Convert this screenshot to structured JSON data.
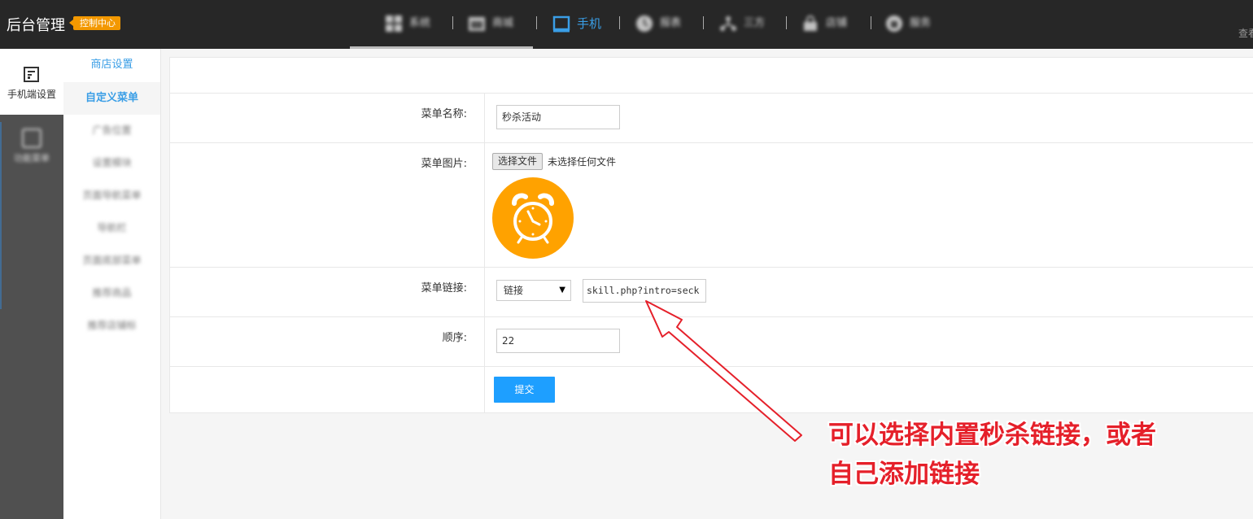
{
  "header": {
    "brand": "后台管理",
    "badge": "控制中心",
    "nav": [
      {
        "label": "系统",
        "icon": "grid-icon"
      },
      {
        "label": "商城",
        "icon": "store-icon"
      },
      {
        "label": "手机",
        "icon": "monitor-icon"
      },
      {
        "label": "报表",
        "icon": "clock-icon"
      },
      {
        "label": "三方",
        "icon": "network-icon"
      },
      {
        "label": "店铺",
        "icon": "shop-icon"
      },
      {
        "label": "服务",
        "icon": "service-icon"
      }
    ],
    "view_text": "查看"
  },
  "sidebar": {
    "active_label": "手机端设置",
    "second_label": "功能菜单"
  },
  "submenu": {
    "items": [
      "商店设置",
      "自定义菜单",
      "广告位置",
      "设置模块",
      "页面导航菜单",
      "导航栏",
      "页面底部菜单",
      "推荐商品",
      "推荐店铺标"
    ]
  },
  "form": {
    "menu_name_label": "菜单名称:",
    "menu_name_value": "秒杀活动",
    "menu_image_label": "菜单图片:",
    "file_button": "选择文件",
    "file_status": "未选择任何文件",
    "menu_link_label": "菜单链接:",
    "link_select": "链接",
    "link_value": "skill.php?intro=seck",
    "order_label": "顺序:",
    "order_value": "22",
    "submit_label": "提交"
  },
  "annotation": {
    "line1": "可以选择内置秒杀链接，或者",
    "line2": "自己添加链接",
    "color": "#e5202a"
  },
  "colors": {
    "topbar": "#272727",
    "accent": "#3a9ee6",
    "badge": "#f39800",
    "submit": "#1e9fff",
    "clock_bg": "#ffa200"
  }
}
